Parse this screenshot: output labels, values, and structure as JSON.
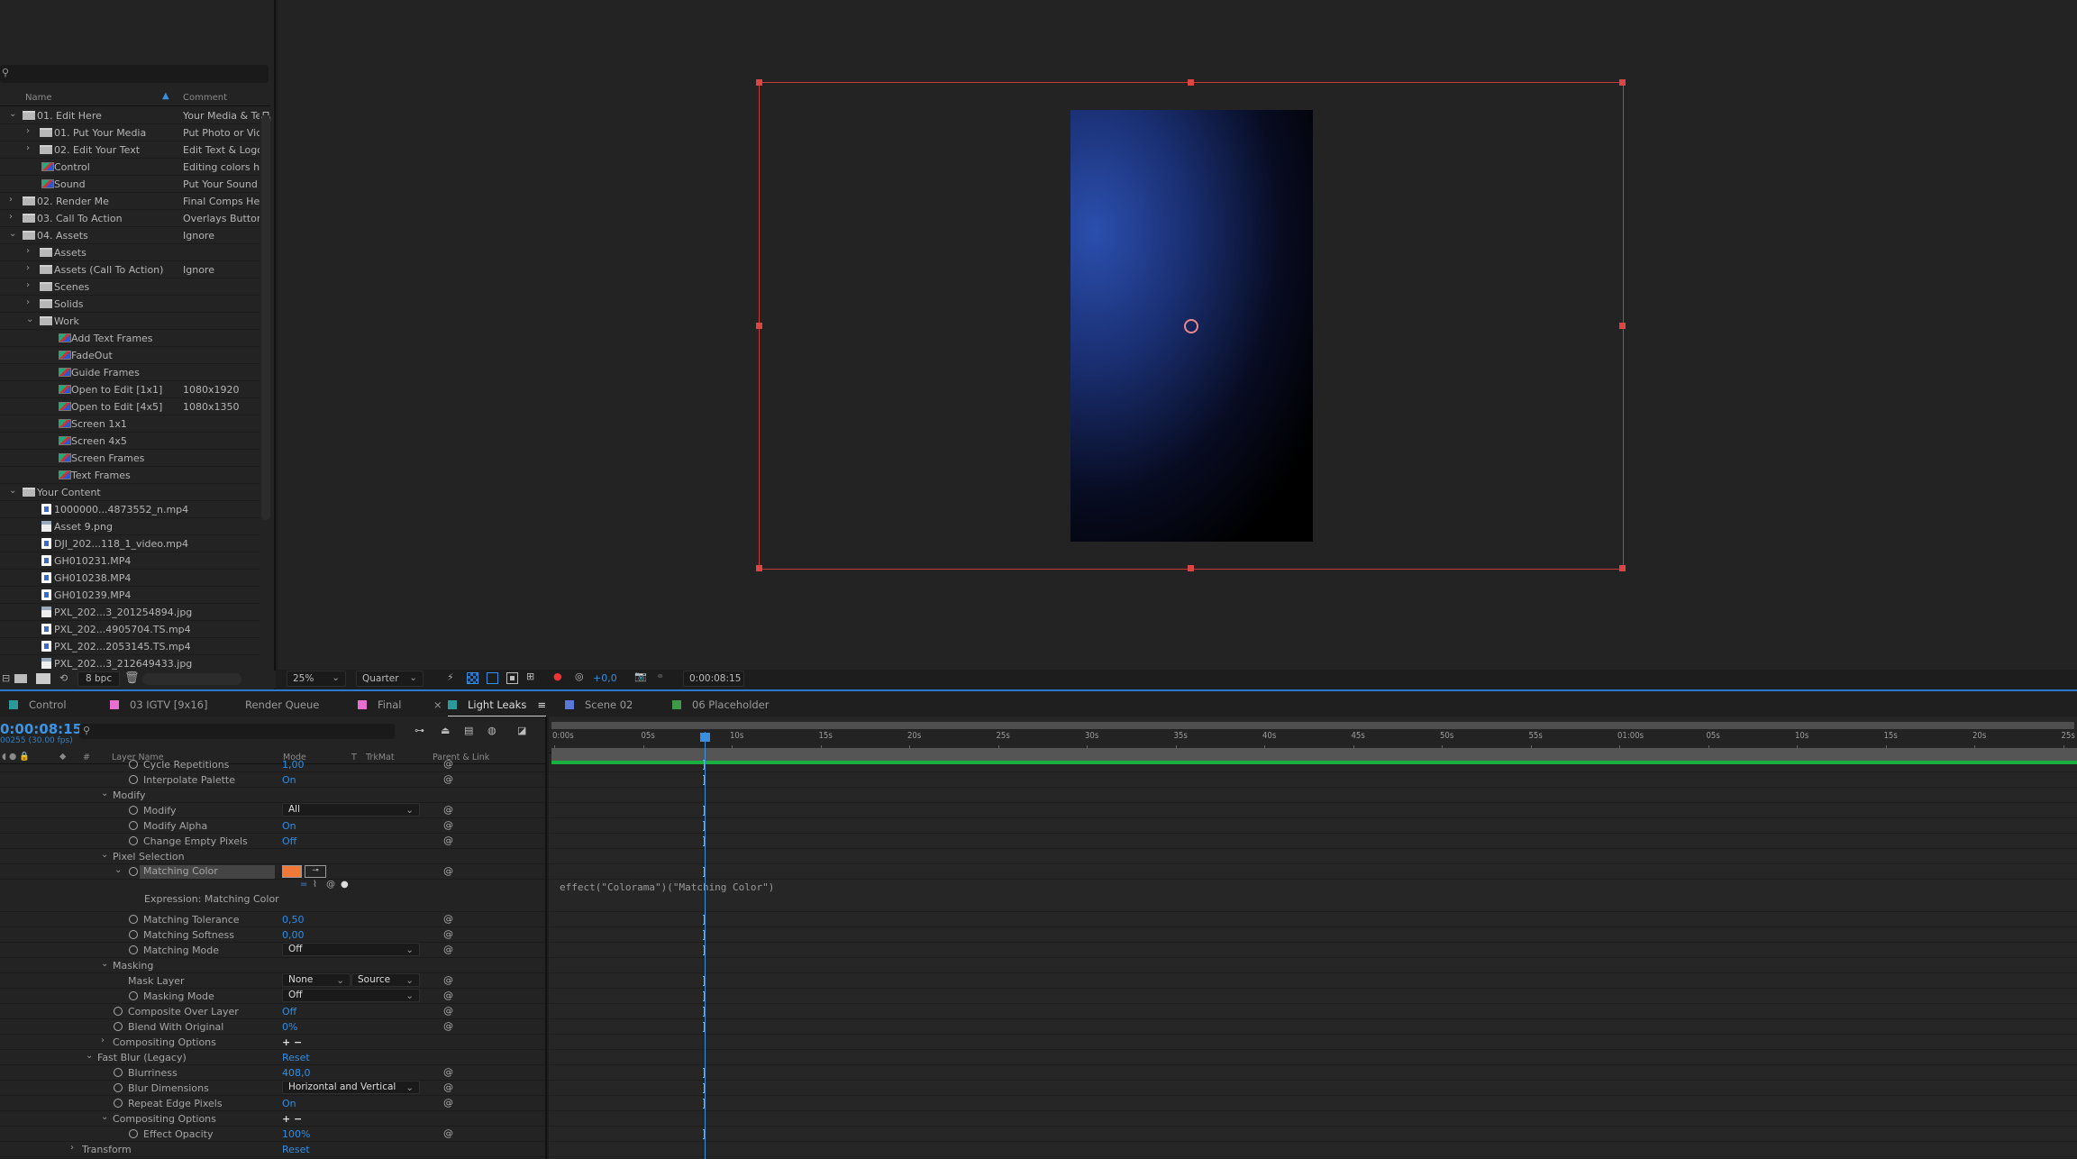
{
  "project": {
    "columns": {
      "name": "Name",
      "comment": "Comment"
    },
    "items": [
      {
        "name": "01. Edit Here",
        "comment": "Your Media & Text",
        "level": 0,
        "type": "folder",
        "state": "open"
      },
      {
        "name": "01. Put Your Media",
        "comment": "Put Photo or Video",
        "level": 1,
        "type": "folder",
        "state": "closed"
      },
      {
        "name": "02. Edit Your Text",
        "comment": "Edit Text & Logo",
        "level": 1,
        "type": "folder",
        "state": "closed"
      },
      {
        "name": "Control",
        "comment": "Editing colors here",
        "level": 1,
        "type": "comp",
        "state": ""
      },
      {
        "name": "Sound",
        "comment": "Put Your Sound",
        "level": 1,
        "type": "comp",
        "state": ""
      },
      {
        "name": "02. Render Me",
        "comment": "Final Comps Here",
        "level": 0,
        "type": "folder",
        "state": "closed"
      },
      {
        "name": "03. Call To Action",
        "comment": "Overlays Buttons",
        "level": 0,
        "type": "folder",
        "state": "closed"
      },
      {
        "name": "04. Assets",
        "comment": "Ignore",
        "level": 0,
        "type": "folder",
        "state": "open"
      },
      {
        "name": "Assets",
        "comment": "",
        "level": 1,
        "type": "folder",
        "state": "closed"
      },
      {
        "name": "Assets (Call To Action)",
        "comment": "Ignore",
        "level": 1,
        "type": "folder",
        "state": "closed"
      },
      {
        "name": "Scenes",
        "comment": "",
        "level": 1,
        "type": "folder",
        "state": "closed"
      },
      {
        "name": "Solids",
        "comment": "",
        "level": 1,
        "type": "folder",
        "state": "closed"
      },
      {
        "name": "Work",
        "comment": "",
        "level": 1,
        "type": "folder",
        "state": "open"
      },
      {
        "name": "Add Text Frames",
        "comment": "",
        "level": 2,
        "type": "comp",
        "state": ""
      },
      {
        "name": "FadeOut",
        "comment": "",
        "level": 2,
        "type": "comp",
        "state": ""
      },
      {
        "name": "Guide Frames",
        "comment": "",
        "level": 2,
        "type": "comp",
        "state": ""
      },
      {
        "name": "Open to Edit [1x1]",
        "comment": "1080x1920",
        "level": 2,
        "type": "comp",
        "state": ""
      },
      {
        "name": "Open to Edit [4x5]",
        "comment": "1080x1350",
        "level": 2,
        "type": "comp",
        "state": ""
      },
      {
        "name": "Screen 1x1",
        "comment": "",
        "level": 2,
        "type": "comp",
        "state": ""
      },
      {
        "name": "Screen 4x5",
        "comment": "",
        "level": 2,
        "type": "comp",
        "state": ""
      },
      {
        "name": "Screen Frames",
        "comment": "",
        "level": 2,
        "type": "comp",
        "state": ""
      },
      {
        "name": "Text Frames",
        "comment": "",
        "level": 2,
        "type": "comp",
        "state": ""
      },
      {
        "name": "Your Content",
        "comment": "",
        "level": 0,
        "type": "folder",
        "state": "open"
      },
      {
        "name": "1000000...4873552_n.mp4",
        "comment": "",
        "level": 1,
        "type": "video",
        "state": ""
      },
      {
        "name": "Asset 9.png",
        "comment": "",
        "level": 1,
        "type": "image",
        "state": ""
      },
      {
        "name": "DJI_202...118_1_video.mp4",
        "comment": "",
        "level": 1,
        "type": "video",
        "state": ""
      },
      {
        "name": "GH010231.MP4",
        "comment": "",
        "level": 1,
        "type": "video",
        "state": ""
      },
      {
        "name": "GH010238.MP4",
        "comment": "",
        "level": 1,
        "type": "video",
        "state": ""
      },
      {
        "name": "GH010239.MP4",
        "comment": "",
        "level": 1,
        "type": "video",
        "state": ""
      },
      {
        "name": "PXL_202...3_201254894.jpg",
        "comment": "",
        "level": 1,
        "type": "image",
        "state": ""
      },
      {
        "name": "PXL_202...4905704.TS.mp4",
        "comment": "",
        "level": 1,
        "type": "video",
        "state": ""
      },
      {
        "name": "PXL_202...2053145.TS.mp4",
        "comment": "",
        "level": 1,
        "type": "video",
        "state": ""
      },
      {
        "name": "PXL_202...3_212649433.jpg",
        "comment": "",
        "level": 1,
        "type": "image",
        "state": ""
      }
    ],
    "bpc": "8 bpc"
  },
  "viewer": {
    "zoom": "25%",
    "resolution": "Quarter",
    "exposure": "+0,0",
    "timecode": "0:00:08:15",
    "box_color": "#c83a3a"
  },
  "tabs": [
    {
      "label": "Control",
      "color": "#2a9a9a",
      "active": false
    },
    {
      "label": "03 IGTV [9x16]",
      "color": "#e86fd0",
      "active": false
    },
    {
      "label": "Render Queue",
      "color": "",
      "active": false
    },
    {
      "label": "Final",
      "color": "#e86fd0",
      "active": false
    },
    {
      "label": "Light Leaks",
      "color": "#2a9a9a",
      "active": true
    },
    {
      "label": "Scene 02",
      "color": "#5a78d8",
      "active": false
    },
    {
      "label": "06 Placeholder",
      "color": "#3f9a48",
      "active": false
    }
  ],
  "timeline": {
    "timecode": "0:00:08:15",
    "frames": "00255 (30.00 fps)",
    "columns": {
      "layer_name": "Layer Name",
      "mode": "Mode",
      "t": "T",
      "trkmat": "TrkMat",
      "parent": "Parent & Link",
      "num": "#"
    },
    "ruler_labels": [
      "0:00s",
      "05s",
      "10s",
      "15s",
      "20s",
      "25s",
      "30s",
      "35s",
      "40s",
      "45s",
      "50s",
      "55s",
      "01:00s",
      "05s",
      "10s",
      "15s",
      "20s",
      "25s"
    ],
    "current_time_seconds": 8.5,
    "expression_text": "effect(\"Colorama\")(\"Matching Color\")",
    "rows": [
      {
        "label": "Cycle Repetitions",
        "level": 4,
        "icon": "stopwatch",
        "value": "1,00",
        "vtype": "text",
        "pw": true
      },
      {
        "label": "Interpolate Palette",
        "level": 4,
        "icon": "stopwatch",
        "value": "On",
        "vtype": "text",
        "pw": true
      },
      {
        "label": "Modify",
        "level": 2,
        "icon": "chevron-down",
        "value": "",
        "vtype": "",
        "pw": false
      },
      {
        "label": "Modify",
        "level": 4,
        "icon": "stopwatch",
        "value": "All",
        "vtype": "dropdown",
        "pw": true
      },
      {
        "label": "Modify Alpha",
        "level": 4,
        "icon": "stopwatch",
        "value": "On",
        "vtype": "text",
        "pw": true
      },
      {
        "label": "Change Empty Pixels",
        "level": 4,
        "icon": "stopwatch",
        "value": "Off",
        "vtype": "text",
        "pw": true
      },
      {
        "label": "Pixel Selection",
        "level": 2,
        "icon": "chevron-down",
        "value": "",
        "vtype": "",
        "pw": false
      },
      {
        "label": "Matching Color",
        "level": 4,
        "icon": "stopwatch-open",
        "value": "#f07838",
        "vtype": "swatch",
        "pw": true
      },
      {
        "label": "Expression: Matching Color",
        "level": 4,
        "icon": "",
        "value": "",
        "vtype": "expression",
        "pw": false
      },
      {
        "label": "Matching Tolerance",
        "level": 4,
        "icon": "stopwatch",
        "value": "0,50",
        "vtype": "text",
        "pw": true
      },
      {
        "label": "Matching Softness",
        "level": 4,
        "icon": "stopwatch",
        "value": "0,00",
        "vtype": "text",
        "pw": true
      },
      {
        "label": "Matching Mode",
        "level": 4,
        "icon": "stopwatch",
        "value": "Off",
        "vtype": "dropdown",
        "pw": true
      },
      {
        "label": "Masking",
        "level": 2,
        "icon": "chevron-down",
        "value": "",
        "vtype": "",
        "pw": false
      },
      {
        "label": "Mask Layer",
        "level": 3,
        "icon": "",
        "value": "None",
        "value2": "Source",
        "vtype": "dual",
        "pw": true
      },
      {
        "label": "Masking Mode",
        "level": 4,
        "icon": "stopwatch",
        "value": "Off",
        "vtype": "dropdown",
        "pw": true
      },
      {
        "label": "Composite Over Layer",
        "level": 3,
        "icon": "stopwatch",
        "value": "Off",
        "vtype": "text",
        "pw": true
      },
      {
        "label": "Blend With Original",
        "level": 3,
        "icon": "stopwatch",
        "value": "0%",
        "vtype": "text",
        "pw": true
      },
      {
        "label": "Compositing Options",
        "level": 2,
        "icon": "chevron-right",
        "value": "+ −",
        "vtype": "plusminus",
        "pw": false
      },
      {
        "label": "Fast Blur (Legacy)",
        "level": 1,
        "icon": "chevron-down",
        "value": "Reset",
        "vtype": "text",
        "pw": false
      },
      {
        "label": "Blurriness",
        "level": 3,
        "icon": "stopwatch",
        "value": "408,0",
        "vtype": "text",
        "pw": true
      },
      {
        "label": "Blur Dimensions",
        "level": 3,
        "icon": "stopwatch",
        "value": "Horizontal and Vertical",
        "vtype": "dropdown",
        "pw": true
      },
      {
        "label": "Repeat Edge Pixels",
        "level": 3,
        "icon": "stopwatch",
        "value": "On",
        "vtype": "text",
        "pw": true
      },
      {
        "label": "Compositing Options",
        "level": 2,
        "icon": "chevron-down",
        "value": "+ −",
        "vtype": "plusminus",
        "pw": false
      },
      {
        "label": "Effect Opacity",
        "level": 4,
        "icon": "stopwatch",
        "value": "100%",
        "vtype": "text",
        "pw": true
      },
      {
        "label": "Transform",
        "level": 0,
        "icon": "chevron-right",
        "value": "Reset",
        "vtype": "text",
        "pw": false
      }
    ]
  }
}
